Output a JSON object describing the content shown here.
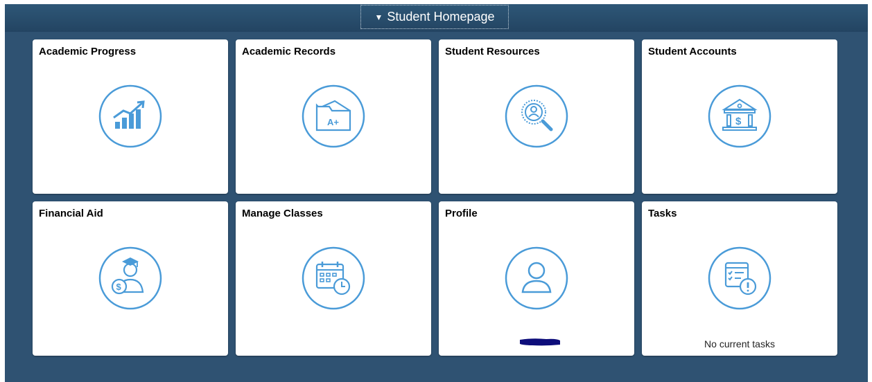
{
  "header": {
    "homepage_label": "Student Homepage",
    "caret_glyph": "▼"
  },
  "tiles": [
    {
      "title": "Academic Progress",
      "icon": "chart-growth-icon"
    },
    {
      "title": "Academic Records",
      "icon": "folder-grade-icon"
    },
    {
      "title": "Student Resources",
      "icon": "search-person-icon"
    },
    {
      "title": "Student Accounts",
      "icon": "bank-dollar-icon"
    },
    {
      "title": "Financial Aid",
      "icon": "graduate-dollar-icon"
    },
    {
      "title": "Manage Classes",
      "icon": "calendar-clock-icon"
    },
    {
      "title": "Profile",
      "icon": "person-icon"
    },
    {
      "title": "Tasks",
      "icon": "task-alert-icon",
      "footer": "No current tasks"
    }
  ],
  "colors": {
    "background": "#2f5272",
    "icon_blue": "#4a9bd8",
    "tile": "#ffffff"
  }
}
